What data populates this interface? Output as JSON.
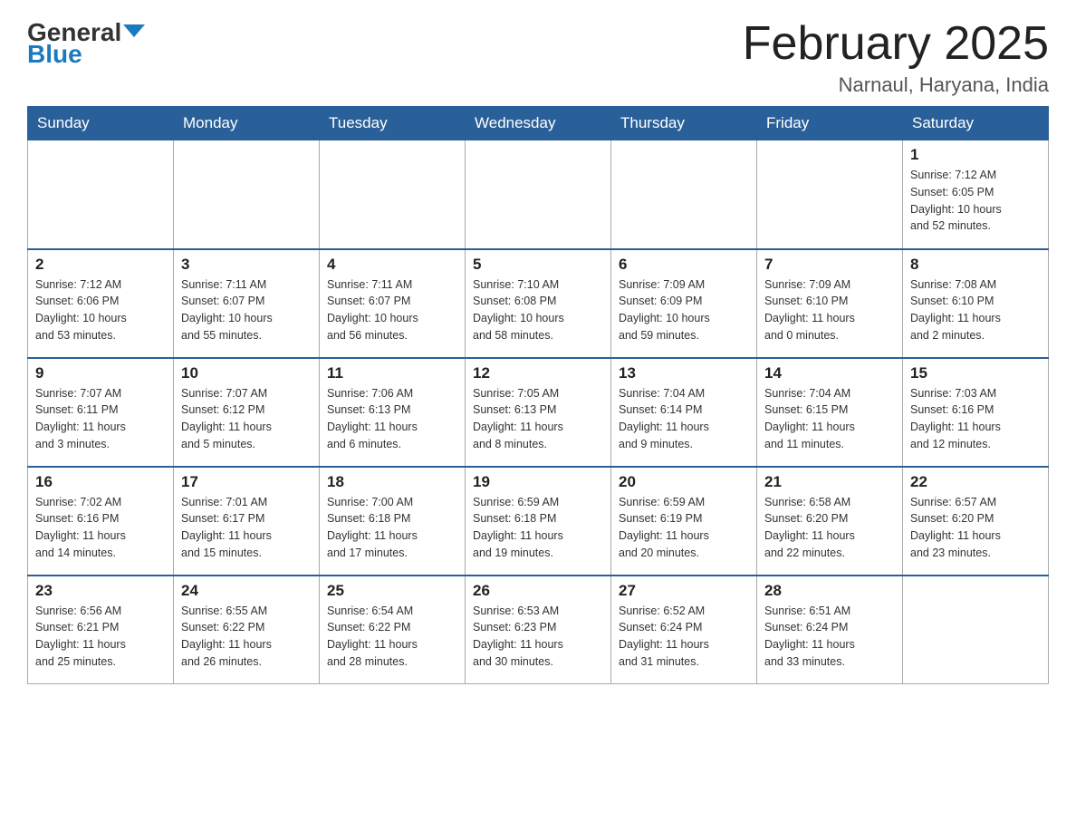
{
  "header": {
    "logo_general": "General",
    "logo_blue": "Blue",
    "month_title": "February 2025",
    "location": "Narnaul, Haryana, India"
  },
  "weekdays": [
    "Sunday",
    "Monday",
    "Tuesday",
    "Wednesday",
    "Thursday",
    "Friday",
    "Saturday"
  ],
  "weeks": [
    [
      {
        "day": "",
        "info": ""
      },
      {
        "day": "",
        "info": ""
      },
      {
        "day": "",
        "info": ""
      },
      {
        "day": "",
        "info": ""
      },
      {
        "day": "",
        "info": ""
      },
      {
        "day": "",
        "info": ""
      },
      {
        "day": "1",
        "info": "Sunrise: 7:12 AM\nSunset: 6:05 PM\nDaylight: 10 hours\nand 52 minutes."
      }
    ],
    [
      {
        "day": "2",
        "info": "Sunrise: 7:12 AM\nSunset: 6:06 PM\nDaylight: 10 hours\nand 53 minutes."
      },
      {
        "day": "3",
        "info": "Sunrise: 7:11 AM\nSunset: 6:07 PM\nDaylight: 10 hours\nand 55 minutes."
      },
      {
        "day": "4",
        "info": "Sunrise: 7:11 AM\nSunset: 6:07 PM\nDaylight: 10 hours\nand 56 minutes."
      },
      {
        "day": "5",
        "info": "Sunrise: 7:10 AM\nSunset: 6:08 PM\nDaylight: 10 hours\nand 58 minutes."
      },
      {
        "day": "6",
        "info": "Sunrise: 7:09 AM\nSunset: 6:09 PM\nDaylight: 10 hours\nand 59 minutes."
      },
      {
        "day": "7",
        "info": "Sunrise: 7:09 AM\nSunset: 6:10 PM\nDaylight: 11 hours\nand 0 minutes."
      },
      {
        "day": "8",
        "info": "Sunrise: 7:08 AM\nSunset: 6:10 PM\nDaylight: 11 hours\nand 2 minutes."
      }
    ],
    [
      {
        "day": "9",
        "info": "Sunrise: 7:07 AM\nSunset: 6:11 PM\nDaylight: 11 hours\nand 3 minutes."
      },
      {
        "day": "10",
        "info": "Sunrise: 7:07 AM\nSunset: 6:12 PM\nDaylight: 11 hours\nand 5 minutes."
      },
      {
        "day": "11",
        "info": "Sunrise: 7:06 AM\nSunset: 6:13 PM\nDaylight: 11 hours\nand 6 minutes."
      },
      {
        "day": "12",
        "info": "Sunrise: 7:05 AM\nSunset: 6:13 PM\nDaylight: 11 hours\nand 8 minutes."
      },
      {
        "day": "13",
        "info": "Sunrise: 7:04 AM\nSunset: 6:14 PM\nDaylight: 11 hours\nand 9 minutes."
      },
      {
        "day": "14",
        "info": "Sunrise: 7:04 AM\nSunset: 6:15 PM\nDaylight: 11 hours\nand 11 minutes."
      },
      {
        "day": "15",
        "info": "Sunrise: 7:03 AM\nSunset: 6:16 PM\nDaylight: 11 hours\nand 12 minutes."
      }
    ],
    [
      {
        "day": "16",
        "info": "Sunrise: 7:02 AM\nSunset: 6:16 PM\nDaylight: 11 hours\nand 14 minutes."
      },
      {
        "day": "17",
        "info": "Sunrise: 7:01 AM\nSunset: 6:17 PM\nDaylight: 11 hours\nand 15 minutes."
      },
      {
        "day": "18",
        "info": "Sunrise: 7:00 AM\nSunset: 6:18 PM\nDaylight: 11 hours\nand 17 minutes."
      },
      {
        "day": "19",
        "info": "Sunrise: 6:59 AM\nSunset: 6:18 PM\nDaylight: 11 hours\nand 19 minutes."
      },
      {
        "day": "20",
        "info": "Sunrise: 6:59 AM\nSunset: 6:19 PM\nDaylight: 11 hours\nand 20 minutes."
      },
      {
        "day": "21",
        "info": "Sunrise: 6:58 AM\nSunset: 6:20 PM\nDaylight: 11 hours\nand 22 minutes."
      },
      {
        "day": "22",
        "info": "Sunrise: 6:57 AM\nSunset: 6:20 PM\nDaylight: 11 hours\nand 23 minutes."
      }
    ],
    [
      {
        "day": "23",
        "info": "Sunrise: 6:56 AM\nSunset: 6:21 PM\nDaylight: 11 hours\nand 25 minutes."
      },
      {
        "day": "24",
        "info": "Sunrise: 6:55 AM\nSunset: 6:22 PM\nDaylight: 11 hours\nand 26 minutes."
      },
      {
        "day": "25",
        "info": "Sunrise: 6:54 AM\nSunset: 6:22 PM\nDaylight: 11 hours\nand 28 minutes."
      },
      {
        "day": "26",
        "info": "Sunrise: 6:53 AM\nSunset: 6:23 PM\nDaylight: 11 hours\nand 30 minutes."
      },
      {
        "day": "27",
        "info": "Sunrise: 6:52 AM\nSunset: 6:24 PM\nDaylight: 11 hours\nand 31 minutes."
      },
      {
        "day": "28",
        "info": "Sunrise: 6:51 AM\nSunset: 6:24 PM\nDaylight: 11 hours\nand 33 minutes."
      },
      {
        "day": "",
        "info": ""
      }
    ]
  ]
}
